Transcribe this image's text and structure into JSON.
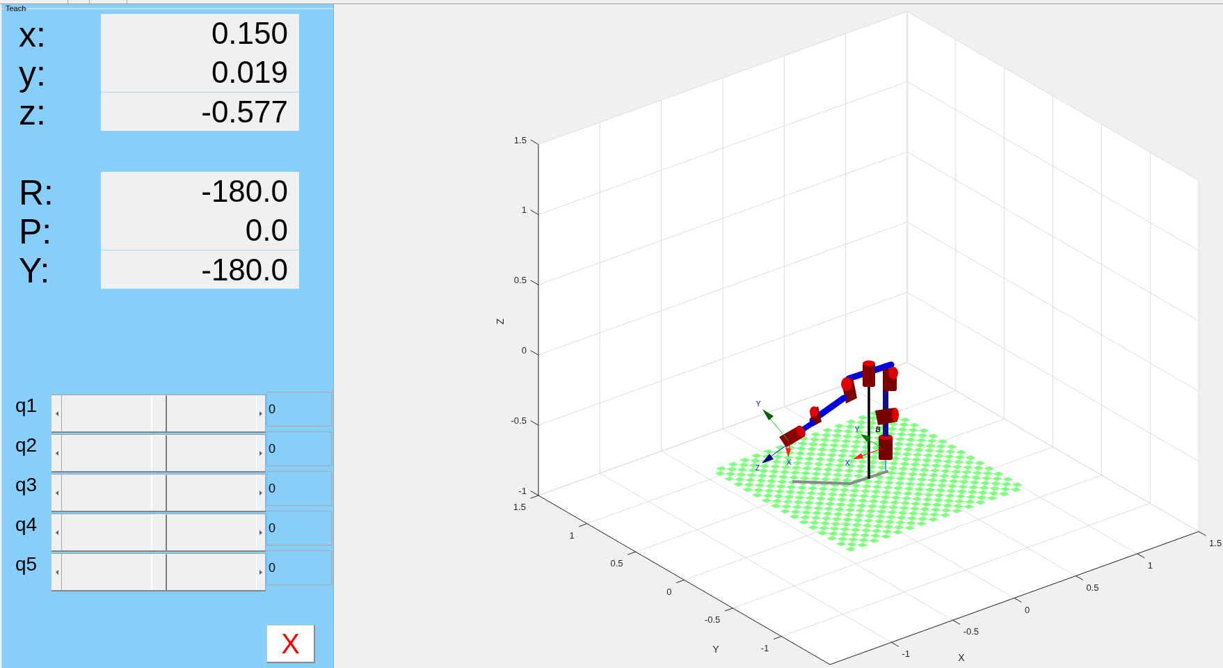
{
  "panel": {
    "title": "Teach"
  },
  "position": [
    {
      "label": "x:",
      "value": "0.150"
    },
    {
      "label": "y:",
      "value": "0.019"
    },
    {
      "label": "z:",
      "value": "-0.577"
    }
  ],
  "orientation": [
    {
      "label": "R:",
      "value": "-180.0"
    },
    {
      "label": "P:",
      "value": "0.0"
    },
    {
      "label": "Y:",
      "value": "-180.0"
    }
  ],
  "joints": [
    {
      "label": "q1",
      "level": 0.5,
      "value": "0"
    },
    {
      "label": "q2",
      "level": 0.5,
      "value": "0"
    },
    {
      "label": "q3",
      "level": 0.5,
      "value": "0"
    },
    {
      "label": "q4",
      "level": 0.5,
      "value": "0"
    },
    {
      "label": "q5",
      "level": 0.5,
      "value": "0"
    }
  ],
  "close_button": {
    "label": "X"
  },
  "plot": {
    "z_axis": {
      "title": "Z",
      "ticks": [
        "1.5",
        "1",
        "0.5",
        "0",
        "-0.5",
        "-1"
      ]
    },
    "y_axis": {
      "title": "Y",
      "ticks": [
        "1.5",
        "1",
        "0.5",
        "0",
        "-0.5",
        "-1"
      ]
    },
    "x_axis": {
      "title": "X",
      "ticks": [
        "-1",
        "-0.5",
        "0",
        "0.5",
        "1",
        "1.5"
      ]
    },
    "frame_labels": [
      {
        "text": "Y",
        "kind": "axis"
      },
      {
        "text": "Y",
        "kind": "axis"
      },
      {
        "text": "B",
        "kind": "frame"
      },
      {
        "text": "X",
        "kind": "axis"
      },
      {
        "text": "X",
        "kind": "axis"
      },
      {
        "text": "Z",
        "kind": "axis"
      }
    ]
  }
}
